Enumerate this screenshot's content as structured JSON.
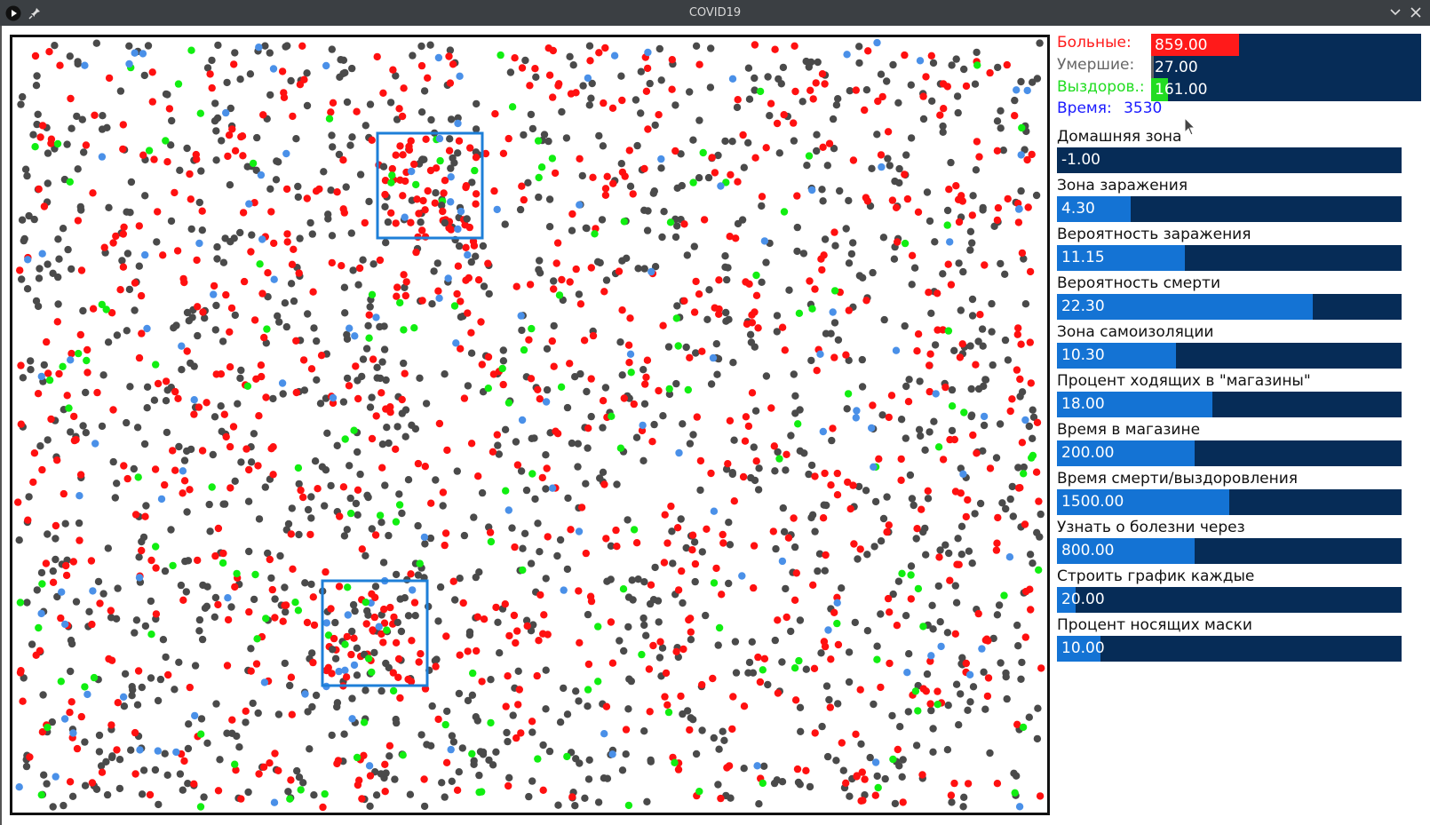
{
  "window": {
    "title": "COVID19"
  },
  "stats": [
    {
      "label": "Больные:",
      "value": "859.00",
      "label_color": "#ff1a1a",
      "fill_color": "#ff1a1a",
      "fill_fraction": 0.325
    },
    {
      "label": "Умершие:",
      "value": "27.00",
      "label_color": "#666666",
      "fill_color": "#666666",
      "fill_fraction": 0.01
    },
    {
      "label": "Выздоров.:",
      "value": "161.00",
      "label_color": "#22dd22",
      "fill_color": "#22dd22",
      "fill_fraction": 0.061
    }
  ],
  "time": {
    "label": "Время:",
    "value": "3530"
  },
  "params": [
    {
      "label": "Домашняя зона",
      "value": "-1.00",
      "fill_fraction": 0.0
    },
    {
      "label": "Зона заражения",
      "value": "4.30",
      "fill_fraction": 0.215
    },
    {
      "label": "Вероятность заражения",
      "value": "11.15",
      "fill_fraction": 0.372
    },
    {
      "label": "Вероятность смерти",
      "value": "22.30",
      "fill_fraction": 0.743
    },
    {
      "label": "Зона самоизоляции",
      "value": "10.30",
      "fill_fraction": 0.345
    },
    {
      "label": "Процент ходящих в \"магазины\"",
      "value": "18.00",
      "fill_fraction": 0.45
    },
    {
      "label": "Время в магазине",
      "value": "200.00",
      "fill_fraction": 0.4
    },
    {
      "label": "Время смерти/выздоровления",
      "value": "1500.00",
      "fill_fraction": 0.5
    },
    {
      "label": "Узнать о болезни через",
      "value": "800.00",
      "fill_fraction": 0.4
    },
    {
      "label": "Строить график каждые",
      "value": "20.00",
      "fill_fraction": 0.055
    },
    {
      "label": "Процент носящих маски",
      "value": "10.00",
      "fill_fraction": 0.126
    }
  ],
  "simulation": {
    "dot_colors": {
      "healthy": "#4a4a4a",
      "sick": "#ff1010",
      "recovered": "#11ee11",
      "isolated": "#4a90e8"
    },
    "zone_color": "#1e7fd8",
    "population_counts": {
      "healthy": 1350,
      "sick": 859,
      "recovered": 161,
      "isolated": 130
    }
  },
  "icons": [
    "play-icon",
    "pin-icon",
    "chevron-down-icon",
    "close-icon"
  ]
}
